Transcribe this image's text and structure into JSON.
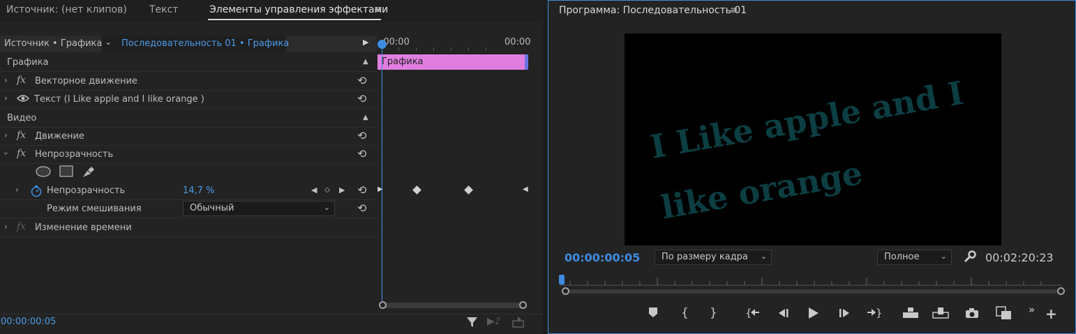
{
  "left_panel": {
    "tabs": [
      {
        "label": "Источник: (нет клипов)"
      },
      {
        "label": "Текст"
      },
      {
        "label": "Элементы управления эффектами"
      }
    ],
    "source_label": "Источник • Графика",
    "sequence_label": "Последовательность 01 • Графика",
    "timeline": {
      "ruler_start": ":00:00",
      "ruler_end": "00:00",
      "clip_label": "Графика"
    },
    "sections": {
      "graphics": "Графика",
      "video": "Видео"
    },
    "effects": {
      "vector_motion": "Векторное движение",
      "text_layer": "Текст (I Like apple and I like orange )",
      "motion": "Движение",
      "opacity": "Непрозрачность",
      "time_remap": "Изменение времени"
    },
    "opacity_param": {
      "label": "Непрозрачность",
      "value": "14,7 %"
    },
    "blend_mode": {
      "label": "Режим смешивания",
      "value": "Обычный"
    },
    "footer_timecode": "00:00:00:05",
    "icons": {
      "fx": "fx",
      "menu": "≡"
    }
  },
  "program_monitor": {
    "title": "Программа: Последовательность 01",
    "video_text_line1": "I Like apple and I",
    "video_text_line2": "like orange",
    "current_timecode": "00:00:00:05",
    "zoom_select": "По размеру кадра",
    "quality_select": "Полное",
    "duration_timecode": "00:02:20:23"
  },
  "colors": {
    "accent": "#3e8de0",
    "clip": "#e07ee0",
    "video_text": "#0c3e42"
  }
}
